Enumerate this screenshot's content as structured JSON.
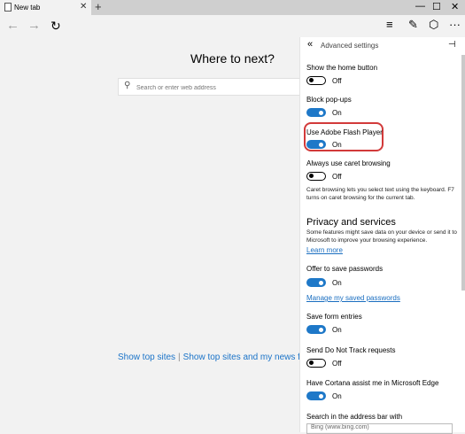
{
  "tab": {
    "title": "New tab"
  },
  "content": {
    "heading": "Where to next?",
    "search_placeholder": "Search or enter web address",
    "link_top_sites": "Show top sites",
    "link_separator": "|",
    "link_top_sites_news": "Show top sites and my news feed"
  },
  "panel": {
    "title": "Advanced settings",
    "show_home": {
      "label": "Show the home button",
      "state": "Off"
    },
    "block_popups": {
      "label": "Block pop-ups",
      "state": "On"
    },
    "flash": {
      "label": "Use Adobe Flash Player",
      "state": "On"
    },
    "caret": {
      "label": "Always use caret browsing",
      "state": "Off",
      "description": "Caret browsing lets you select text using the keyboard. F7 turns on caret browsing for the current tab."
    },
    "privacy": {
      "title": "Privacy and services",
      "description": "Some features might save data on your device or send it to Microsoft to improve your browsing experience.",
      "learn_more": "Learn more"
    },
    "save_passwords": {
      "label": "Offer to save passwords",
      "state": "On",
      "link": "Manage my saved passwords"
    },
    "form_entries": {
      "label": "Save form entries",
      "state": "On"
    },
    "do_not_track": {
      "label": "Send Do Not Track requests",
      "state": "Off"
    },
    "cortana": {
      "label": "Have Cortana assist me in Microsoft Edge",
      "state": "On"
    },
    "search_bar": {
      "label": "Search in the address bar with",
      "value": "Bing (www.bing.com)"
    }
  },
  "colors": {
    "accent": "#1e78c8",
    "highlight": "#d23a3a",
    "link": "#1a73c8"
  }
}
